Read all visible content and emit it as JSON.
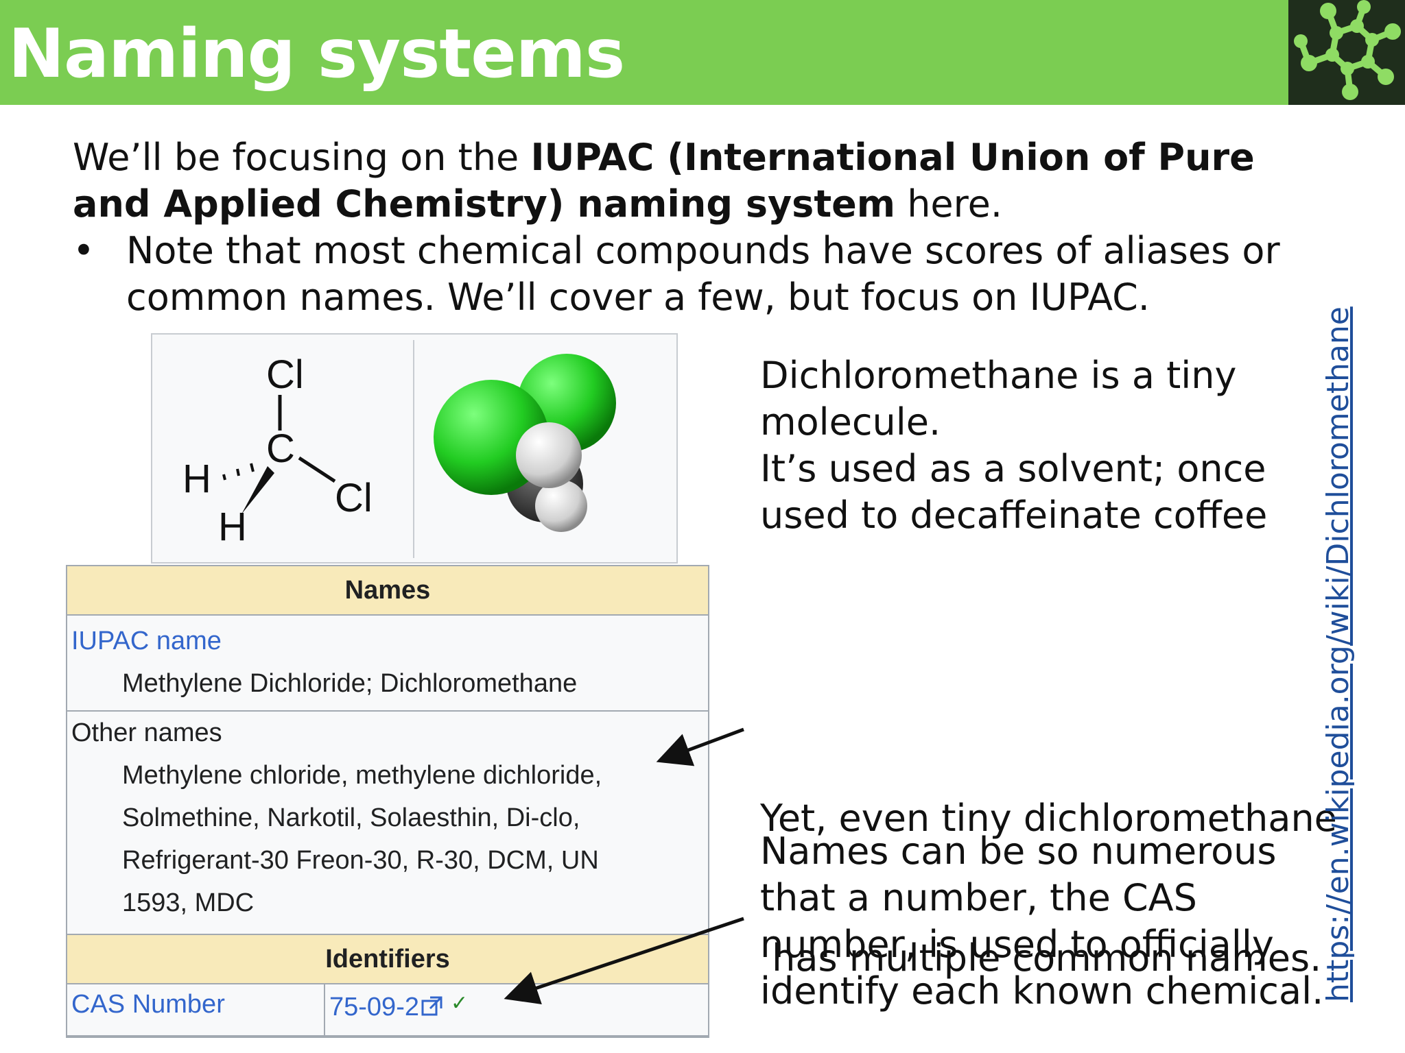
{
  "slide": {
    "title": "Naming systems",
    "intro_plain_1": "We’ll be focusing on the ",
    "intro_bold": "IUPAC (International Union of Pure and Applied Chemistry) naming system",
    "intro_plain_2": " here.",
    "bullet_symbol": "•",
    "bullet_text": "Note that most chemical compounds have scores of aliases or common names. We’ll cover a few, but focus on IUPAC."
  },
  "structure": {
    "atom_cl_top": "Cl",
    "atom_c": "C",
    "atom_cl_right": "Cl",
    "atom_h_left": "H",
    "atom_h_bottom": "H",
    "colors": {
      "chlorine": "#22cc22",
      "carbon": "#333333",
      "hydrogen": "#e6e6e6"
    }
  },
  "infobox": {
    "names_header": "Names",
    "iupac_label": "IUPAC name",
    "iupac_value": "Methylene Dichloride; Dichloromethane",
    "other_label": "Other names",
    "other_lines": [
      "Methylene chloride, methylene dichloride,",
      "Solmethine, Narkotil, Solaesthin, Di-clo,",
      "Refrigerant-30 Freon-30, R-30, DCM, UN",
      "1593, MDC"
    ],
    "identifiers_header": "Identifiers",
    "cas_label": "CAS Number",
    "cas_value": "75-09-2",
    "cas_check": "✓"
  },
  "notes": {
    "molecule_lines": [
      "Dichloromethane is a tiny",
      "molecule.",
      "It’s used as a solvent; once",
      "used to decaffeinate coffee"
    ],
    "names_lines": [
      "Yet, even tiny dichloromethane",
      " has multiple common names."
    ],
    "cas_lines": [
      "Names can be so numerous",
      "that a number, the CAS",
      "number, is used to officially",
      "identify each known chemical."
    ]
  },
  "source_link": "https://en.wikipedia.org/wiki/Dichloromethane",
  "colors": {
    "header_green": "#7bcd52",
    "logo_bg": "#1f2e1c",
    "logo_nodes": "#8fdc64",
    "infobox_header": "#f8eaba",
    "link_blue": "#3366cc"
  }
}
